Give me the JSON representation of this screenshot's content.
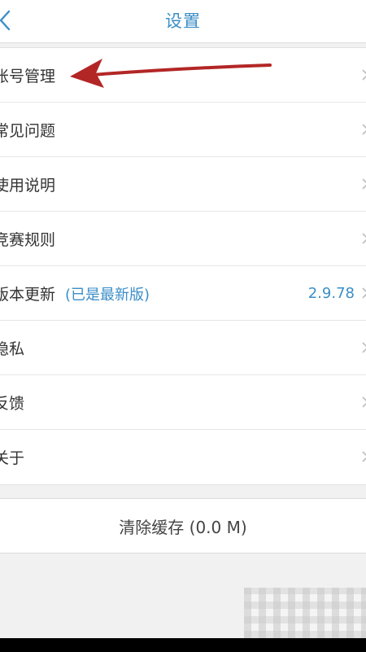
{
  "header": {
    "title": "设置",
    "back_icon": "chevron-left-icon"
  },
  "settings": {
    "items": [
      {
        "label": "账号管理"
      },
      {
        "label": "常见问题"
      },
      {
        "label": "使用说明"
      },
      {
        "label": "竞赛规则"
      },
      {
        "label": "版本更新",
        "sub": "(已是最新版)",
        "value": "2.9.78"
      },
      {
        "label": "隐私"
      },
      {
        "label": "反馈"
      },
      {
        "label": "关于"
      }
    ]
  },
  "cache": {
    "label": "清除缓存 (0.0 M)"
  },
  "annotation": {
    "arrow_color": "#b32626",
    "points_to": "账号管理"
  },
  "colors": {
    "accent": "#3b8ec7",
    "text": "#333333",
    "background": "#f1f1f1"
  }
}
